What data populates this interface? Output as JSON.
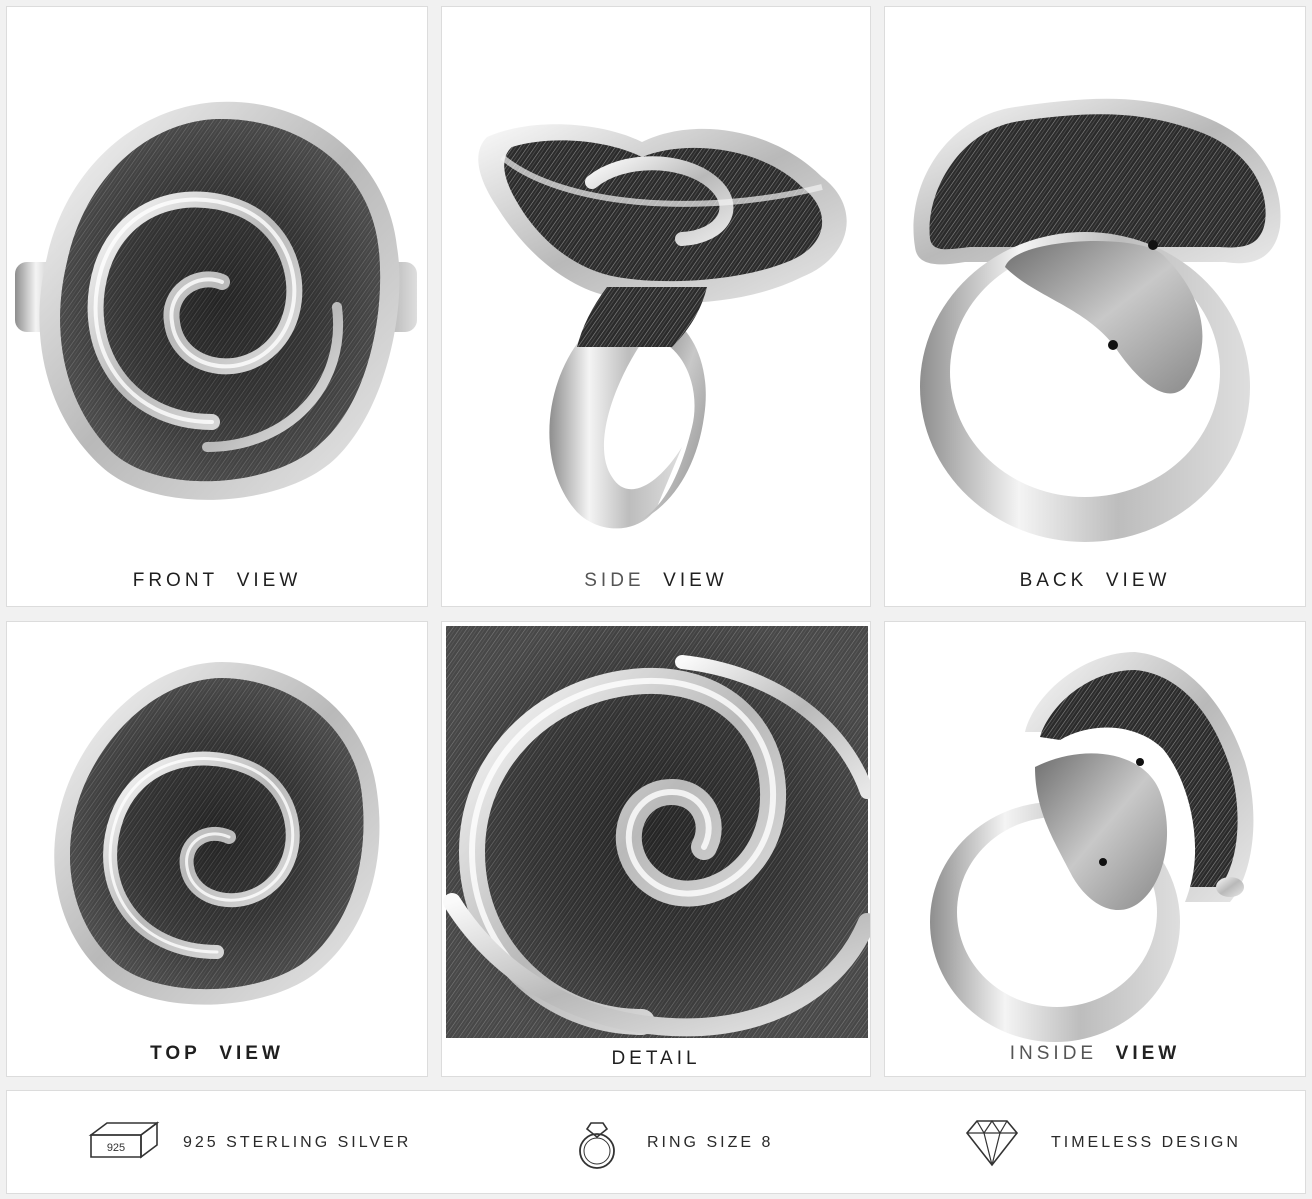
{
  "panels": [
    {
      "id": "front",
      "caption_a": "FRONT",
      "caption_b": "VIEW"
    },
    {
      "id": "side",
      "caption_a": "SIDE",
      "caption_b": "VIEW"
    },
    {
      "id": "back",
      "caption_a": "BACK",
      "caption_b": "VIEW"
    },
    {
      "id": "top",
      "caption_a": "TOP",
      "caption_b": "VIEW"
    },
    {
      "id": "detail",
      "caption_a": "DETAIL",
      "caption_b": ""
    },
    {
      "id": "inside",
      "caption_a": "INSIDE",
      "caption_b": "VIEW"
    }
  ],
  "features": [
    {
      "icon": "silver-bar-icon",
      "icon_text": "925",
      "label": "925 STERLING SILVER"
    },
    {
      "icon": "ring-icon",
      "label": "RING SIZE 8"
    },
    {
      "icon": "diamond-icon",
      "label": "TIMELESS DESIGN"
    }
  ],
  "colors": {
    "background": "#f1f1f1",
    "panel": "#ffffff",
    "silver_light": "#e6e6e6",
    "silver_mid": "#9a9a9a",
    "silver_dark": "#2e2e2e"
  }
}
